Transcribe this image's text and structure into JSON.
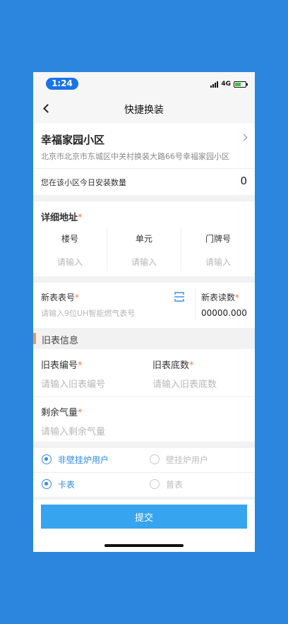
{
  "status_bar": {
    "time": "1:24",
    "network": "4G"
  },
  "nav": {
    "title": "快捷换装"
  },
  "community": {
    "name": "幸福家园小区",
    "address": "北京市北京市东城区中关村换装大路66号幸福家园小区"
  },
  "install_count": {
    "label": "您在该小区今日安装数量",
    "value": "0"
  },
  "detail_address": {
    "label": "详细地址",
    "required_mark": "*",
    "fields": [
      {
        "label": "楼号",
        "placeholder": "请输入"
      },
      {
        "label": "单元",
        "placeholder": "请输入"
      },
      {
        "label": "门牌号",
        "placeholder": "请输入"
      }
    ]
  },
  "new_meter": {
    "number_label": "新表表号",
    "number_placeholder": "请输入9位UH智能燃气表号",
    "reading_label": "新表读数",
    "reading_value": "00000.000",
    "required_mark": "*"
  },
  "old_meter": {
    "section_title": "旧表信息",
    "number_label": "旧表编号",
    "number_placeholder": "请输入旧表编号",
    "base_label": "旧表底数",
    "base_placeholder": "请输入旧表底数",
    "remaining_label": "剩余气量",
    "remaining_placeholder": "请输入剩余气量",
    "required_mark": "*"
  },
  "user_type": {
    "options": [
      {
        "label": "非壁挂炉用户",
        "selected": true
      },
      {
        "label": "壁挂炉用户",
        "selected": false
      }
    ]
  },
  "meter_type": {
    "options": [
      {
        "label": "卡表",
        "selected": true
      },
      {
        "label": "普表",
        "selected": false
      }
    ]
  },
  "submit": {
    "label": "提交"
  },
  "colors": {
    "background": "#2c86dd",
    "accent": "#2c8be6",
    "button": "#36a4ef",
    "required": "#f07b3f"
  }
}
